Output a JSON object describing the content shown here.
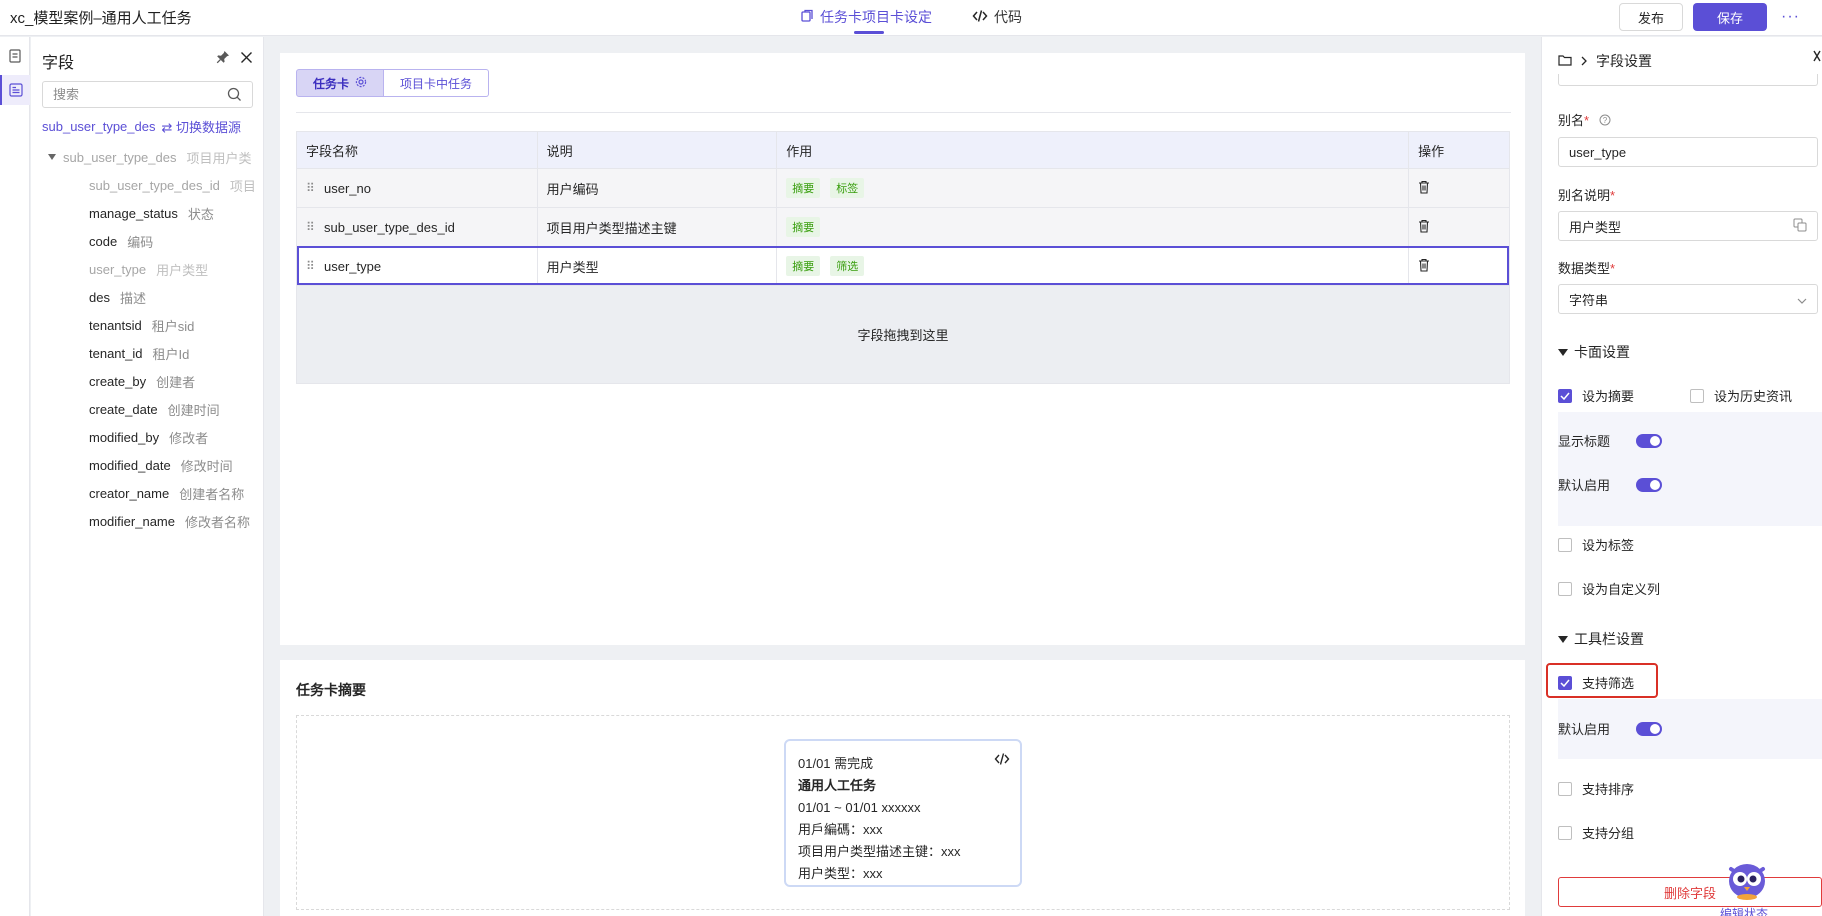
{
  "header": {
    "app_title": "xc_模型案例–通用人工任务",
    "tabs": [
      {
        "label": "任务卡项目卡设定",
        "active": true
      },
      {
        "label": "代码",
        "active": false
      }
    ],
    "publish_label": "发布",
    "save_label": "保存",
    "more_label": "···"
  },
  "field_panel": {
    "title": "字段",
    "search_placeholder": "搜索",
    "source_name": "sub_user_type_des",
    "switch_source_label": "⇄ 切换数据源",
    "root": {
      "name": "sub_user_type_des",
      "desc": "项目用户类"
    },
    "fields": [
      {
        "name": "sub_user_type_des_id",
        "desc": "项目",
        "dim": true
      },
      {
        "name": "manage_status",
        "desc": "状态",
        "dim": false
      },
      {
        "name": "code",
        "desc": "编码",
        "dim": false
      },
      {
        "name": "user_type",
        "desc": "用户类型",
        "dim": true
      },
      {
        "name": "des",
        "desc": "描述",
        "dim": false
      },
      {
        "name": "tenantsid",
        "desc": "租户sid",
        "dim": false
      },
      {
        "name": "tenant_id",
        "desc": "租户Id",
        "dim": false
      },
      {
        "name": "create_by",
        "desc": "创建者",
        "dim": false
      },
      {
        "name": "create_date",
        "desc": "创建时间",
        "dim": false
      },
      {
        "name": "modified_by",
        "desc": "修改者",
        "dim": false
      },
      {
        "name": "modified_date",
        "desc": "修改时间",
        "dim": false
      },
      {
        "name": "creator_name",
        "desc": "创建者名称",
        "dim": false
      },
      {
        "name": "modifier_name",
        "desc": "修改者名称",
        "dim": false
      }
    ]
  },
  "main": {
    "segments": [
      {
        "label": "任务卡",
        "active": true
      },
      {
        "label": "项目卡中任务",
        "active": false
      }
    ],
    "table": {
      "headers": [
        "字段名称",
        "说明",
        "作用",
        "操作"
      ],
      "rows": [
        {
          "name": "user_no",
          "desc": "用户编码",
          "tags": [
            "摘要",
            "标签"
          ],
          "selected": false
        },
        {
          "name": "sub_user_type_des_id",
          "desc": "项目用户类型描述主键",
          "tags": [
            "摘要"
          ],
          "selected": false
        },
        {
          "name": "user_type",
          "desc": "用户类型",
          "tags": [
            "摘要",
            "筛选"
          ],
          "selected": true
        }
      ],
      "drop_hint": "字段拖拽到这里"
    }
  },
  "summary": {
    "title": "任务卡摘要",
    "preview_lines": [
      {
        "text": "01/01 需完成",
        "bold": false
      },
      {
        "text": "通用人工任务",
        "bold": true
      },
      {
        "text": "01/01 ~ 01/01 xxxxxx",
        "bold": false
      },
      {
        "text": "用戶編碼：xxx",
        "bold": false
      },
      {
        "text": "项目用户类型描述主键：xxx",
        "bold": false
      },
      {
        "text": "用户类型：xxx",
        "bold": false
      }
    ]
  },
  "settings": {
    "title": "字段设置",
    "alias_label": "别名",
    "alias_value": "user_type",
    "alias_desc_label": "别名说明",
    "alias_desc_value": "用户类型",
    "data_type_label": "数据类型",
    "data_type_value": "字符串",
    "card_section": "卡面设置",
    "set_summary": "设为摘要",
    "set_history": "设为历史资讯",
    "show_title": "显示标题",
    "default_enable": "默认启用",
    "set_tag": "设为标签",
    "set_custom_col": "设为自定义列",
    "toolbar_section": "工具栏设置",
    "support_filter": "支持筛选",
    "default_enable_2": "默认启用",
    "support_sort": "支持排序",
    "support_group": "支持分组",
    "delete_label": "删除字段",
    "mascot_label": "编辑状态"
  },
  "colors": {
    "accent": "#5b4fd6",
    "danger": "#e03b3b",
    "tag_bg": "#e8f5e6",
    "tag_text": "#389e0d"
  }
}
